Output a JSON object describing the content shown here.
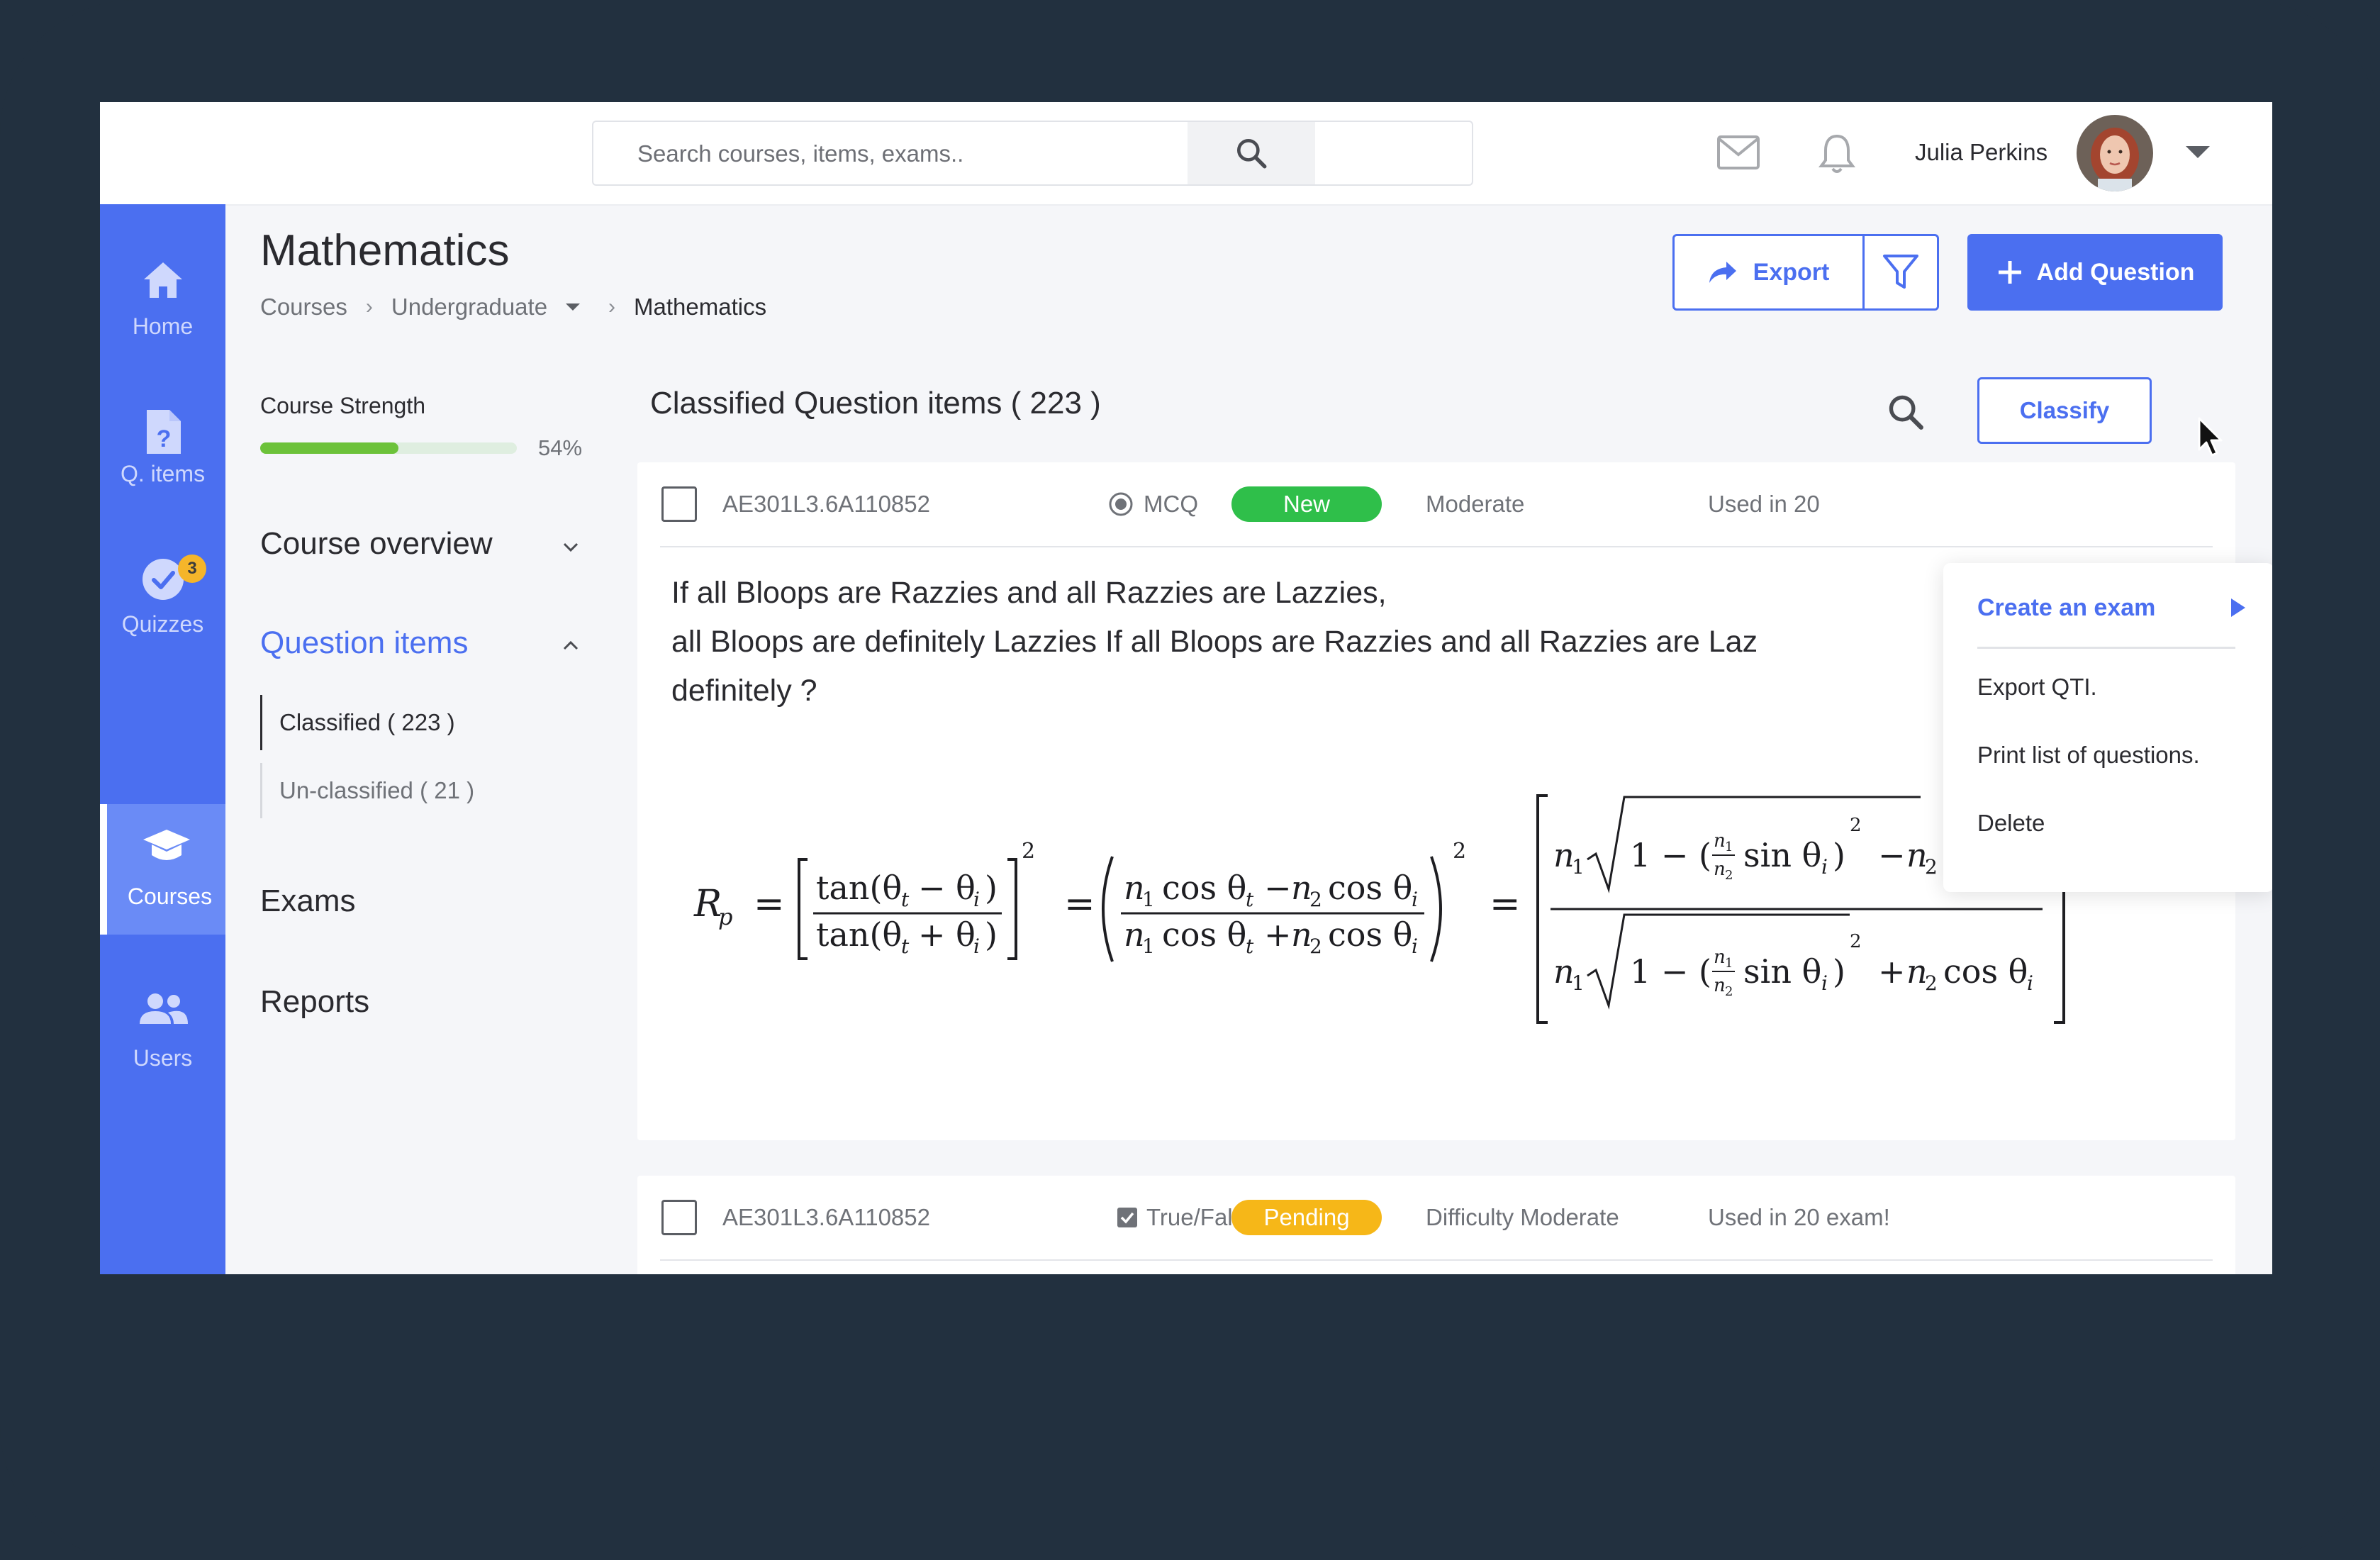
{
  "topbar": {
    "search_placeholder": "Search courses, items, exams..",
    "user_name": "Julia Perkins"
  },
  "sidebar": {
    "items": [
      {
        "label": "Home",
        "icon": "home-icon"
      },
      {
        "label": "Q. items",
        "icon": "question-file-icon"
      },
      {
        "label": "Quizzes",
        "icon": "check-circle-icon",
        "badge": "3"
      },
      {
        "label": "Courses",
        "icon": "graduation-cap-icon",
        "active": true
      },
      {
        "label": "Users",
        "icon": "users-icon"
      }
    ]
  },
  "header": {
    "title": "Mathematics",
    "breadcrumb": [
      "Courses",
      "Undergraduate",
      "Mathematics"
    ],
    "export_label": "Export",
    "add_label": "Add Question"
  },
  "left_panel": {
    "strength_label": "Course Strength",
    "strength_value": 0.54,
    "strength_text": "54%",
    "sections": {
      "overview": "Course overview",
      "question_items": "Question items",
      "exams": "Exams",
      "reports": "Reports"
    },
    "sub_items": [
      "Classified ( 223 )",
      "Un-classified ( 21 )"
    ]
  },
  "main": {
    "list_title": "Classified Question items ( 223 )",
    "classify_label": "Classify",
    "cards": [
      {
        "id": "AE301L3.6A110852",
        "type": "MCQ",
        "status": "New",
        "status_color": "#2fbf4a",
        "difficulty": "Moderate",
        "used": "Used in 20",
        "text_line1": "If all Bloops are Razzies and all Razzies are Lazzies,",
        "text_line2": "all Bloops are definitely Lazzies If all Bloops are Razzies and all Razzies are Laz",
        "text_line3": "definitely ?"
      },
      {
        "id": "AE301L3.6A110852",
        "type": "True/False",
        "status": "Pending",
        "status_color": "#f6b718",
        "difficulty": "Difficulty Moderate",
        "used": "Used in 20 exam!"
      }
    ]
  },
  "dropdown": {
    "items": [
      "Create an exam",
      "Export QTI.",
      "Print list of questions.",
      "Delete"
    ]
  }
}
